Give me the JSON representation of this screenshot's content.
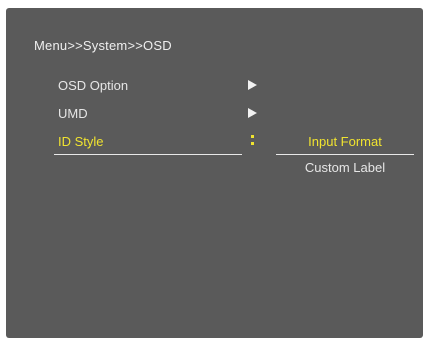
{
  "breadcrumb": "Menu>>System>>OSD",
  "menu": {
    "items": [
      {
        "label": "OSD Option",
        "indicator": "right-arrow-icon"
      },
      {
        "label": "UMD",
        "indicator": "right-arrow-icon"
      },
      {
        "label": "ID Style",
        "indicator": "colon-icon",
        "highlighted": true
      }
    ]
  },
  "id_style_options": {
    "selected": "Input Format",
    "other": "Custom Label"
  },
  "colors": {
    "background": "#5a5a5a",
    "text": "#e6e6e6",
    "highlight": "#f0e330"
  }
}
